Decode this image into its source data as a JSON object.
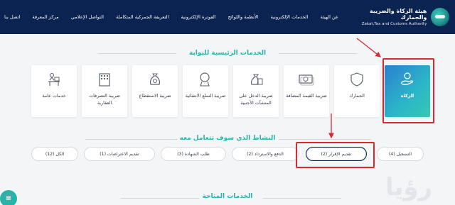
{
  "header": {
    "logo_ar": "هيئة الزكاة والضريبة والجمارك",
    "logo_en": "Zakat,Tax and Customs Authority",
    "nav": [
      "عن الهيئة",
      "الخدمات الإلكترونية",
      "الأنظمة واللوائح",
      "الفوترة الإلكترونية",
      "التعريفة الجمركية المتكاملة",
      "التواصل الإعلامي",
      "مركز المعرفة",
      "اتصل بنا"
    ]
  },
  "main_services": {
    "title": "الخدمات الرئيسية للبوابة",
    "cards": [
      {
        "label": "الزكاة",
        "icon": "zakat-hand-icon",
        "active": true
      },
      {
        "label": "الجمارك",
        "icon": "shield-icon"
      },
      {
        "label": "ضريبة القيمة المضافة",
        "icon": "vat-money-icon"
      },
      {
        "label": "ضريبة الدخل على المنشآت الأجنبية",
        "icon": "income-tax-bag-icon"
      },
      {
        "label": "ضريبة السلع الانتقائية",
        "icon": "sar-tag-icon"
      },
      {
        "label": "ضريبة الاستقطاع",
        "icon": "withholding-bag-icon"
      },
      {
        "label": "ضريبة التصرفات العقارية",
        "icon": "rett-building-icon"
      },
      {
        "label": "خدمات عامة",
        "icon": "desk-person-icon"
      }
    ]
  },
  "activities": {
    "title": "النشاط الذي سوف تتعامل معه",
    "tabs": [
      {
        "label": "التسجيل (4)"
      },
      {
        "label": "تقديم الإقرار (2)",
        "active": true
      },
      {
        "label": "الدفع والاسترداد (2)"
      },
      {
        "label": "طلب الشهادة (3)"
      },
      {
        "label": "تقديم الاعتراضات (1)"
      },
      {
        "label": "الكل (12)"
      }
    ]
  },
  "available_services": {
    "title": "الخدمات المتاحة"
  },
  "watermark": "رؤيا",
  "colors": {
    "header_bg": "#0b2350",
    "accent": "#2bb3a7",
    "annotation_red": "#d9282f"
  }
}
